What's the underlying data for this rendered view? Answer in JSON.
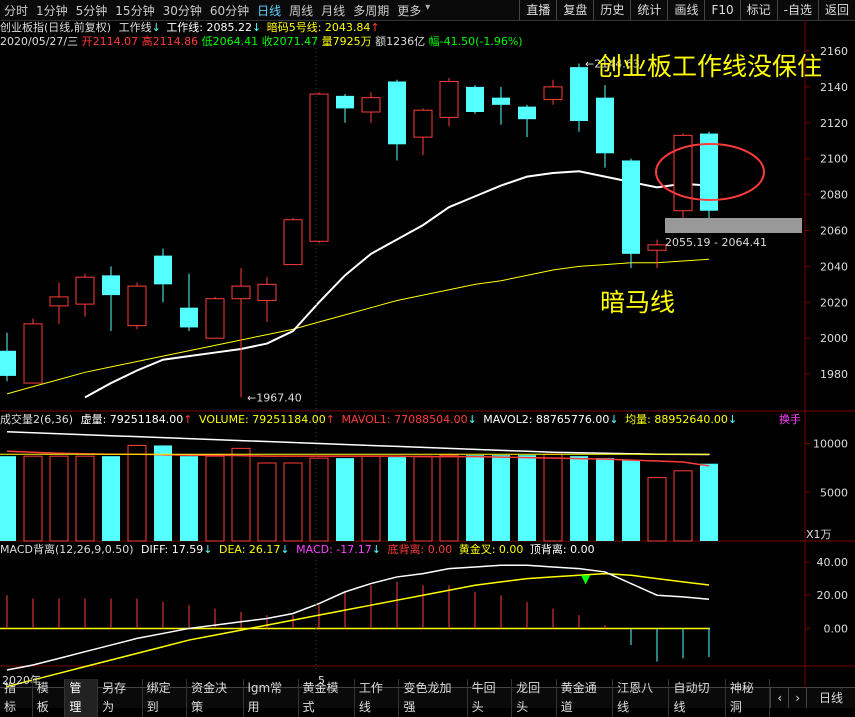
{
  "topbar": {
    "periods": [
      "分时",
      "1分钟",
      "5分钟",
      "15分钟",
      "30分钟",
      "60分钟",
      "日线",
      "周线",
      "月线",
      "多周期",
      "更多"
    ],
    "active_period": "日线",
    "right_buttons": [
      "直播",
      "复盘",
      "历史",
      "统计",
      "画线",
      "F10",
      "标记",
      "-自选",
      "返回"
    ]
  },
  "info": {
    "line1_name": "创业板指(日线,前复权)",
    "line1_ind1": "工作线",
    "line1_ind2": "工作线: 2085.22",
    "line1_ind3": "暗码5号线: 2043.84",
    "line2_date": "2020/05/27/三",
    "line2_open": "开2114.07",
    "line2_high": "高2114.86",
    "line2_low": "低2064.41",
    "line2_close": "收2071.47",
    "line2_vol": "量7925万",
    "line2_amt": "额1236亿",
    "line2_chg": "幅-41.50(-1.96%)"
  },
  "colors": {
    "up": "#ff3b3b",
    "down": "#54ffff",
    "white": "#ffffff",
    "yellow": "#ffff00",
    "grid": "#7a0000"
  },
  "price_axis": [
    "2160",
    "2140",
    "2120",
    "2100",
    "2080",
    "2060",
    "2040",
    "2020",
    "2000",
    "1980"
  ],
  "price_labels": {
    "high": "2144.63",
    "low": "1967.40",
    "box": "2055.19 - 2064.41"
  },
  "annotations": {
    "title": "创业板工作线没保住",
    "line": "暗马线"
  },
  "volume": {
    "label": "成交量2(6,36)",
    "xu": "虚量: 79251184.00",
    "vol": "VOLUME: 79251184.00",
    "mavol1": "MAVOL1: 77088504.00",
    "mavol2": "MAVOL2: 88765776.00",
    "jun": "均量: 88952640.00",
    "huan": "换手",
    "axis": [
      "10000",
      "5000"
    ],
    "unit": "X1万"
  },
  "macd": {
    "label": "MACD背离(12,26,9,0.50)",
    "diff": "DIFF: 17.59",
    "dea": "DEA: 26.17",
    "macd": "MACD: -17.17",
    "dibeili": "底背离: 0.00",
    "huangjincha": "黄金叉: 0.00",
    "dingbeili": "顶背离: 0.00",
    "axis": [
      "40.00",
      "20.00",
      "0.00"
    ]
  },
  "time_axis": {
    "year": "2020年",
    "month": "5"
  },
  "bottom_tabs": [
    "指标",
    "模板",
    "管理",
    "另存为",
    "绑定到",
    "资金决策",
    "lgm常用",
    "黄金模式",
    "工作线",
    "变色龙加强",
    "牛回头",
    "龙回头",
    "黄金通道",
    "江恩八线",
    "自动切线",
    "神秘洞"
  ],
  "bottom_active": "管理",
  "bottom_right": "日线",
  "chart_data": {
    "type": "candlestick",
    "candles": [
      {
        "o": 1993,
        "c": 1979,
        "h": 2003,
        "l": 1976
      },
      {
        "o": 1975,
        "c": 2008,
        "h": 2011,
        "l": 1975
      },
      {
        "o": 2018,
        "c": 2023,
        "h": 2031,
        "l": 2008
      },
      {
        "o": 2019,
        "c": 2034,
        "h": 2036,
        "l": 2012
      },
      {
        "o": 2035,
        "c": 2024,
        "h": 2040,
        "l": 2004
      },
      {
        "o": 2007,
        "c": 2029,
        "h": 2031,
        "l": 2005
      },
      {
        "o": 2046,
        "c": 2030,
        "h": 2050,
        "l": 2020
      },
      {
        "o": 2017,
        "c": 2006,
        "h": 2036,
        "l": 2004
      },
      {
        "o": 2000,
        "c": 2022,
        "h": 2023,
        "l": 2006
      },
      {
        "o": 2022,
        "c": 2029,
        "h": 2039,
        "l": 1967
      },
      {
        "o": 2021,
        "c": 2030,
        "h": 2034,
        "l": 2009
      },
      {
        "o": 2041,
        "c": 2066,
        "h": 2067,
        "l": 2043
      },
      {
        "o": 2054,
        "c": 2136,
        "h": 2137,
        "l": 2053
      },
      {
        "o": 2135,
        "c": 2128,
        "h": 2136,
        "l": 2120
      },
      {
        "o": 2126,
        "c": 2134,
        "h": 2137,
        "l": 2120
      },
      {
        "o": 2143,
        "c": 2108,
        "h": 2144,
        "l": 2099
      },
      {
        "o": 2112,
        "c": 2127,
        "h": 2128,
        "l": 2102
      },
      {
        "o": 2123,
        "c": 2143,
        "h": 2145,
        "l": 2118
      },
      {
        "o": 2140,
        "c": 2126,
        "h": 2141,
        "l": 2125
      },
      {
        "o": 2134,
        "c": 2130,
        "h": 2140,
        "l": 2119
      },
      {
        "o": 2129,
        "c": 2122,
        "h": 2130,
        "l": 2112
      },
      {
        "o": 2133,
        "c": 2140,
        "h": 2144,
        "l": 2130
      },
      {
        "o": 2151,
        "c": 2121,
        "h": 2153,
        "l": 2115
      },
      {
        "o": 2134,
        "c": 2103,
        "h": 2141,
        "l": 2095
      },
      {
        "o": 2099,
        "c": 2047,
        "h": 2100,
        "l": 2039
      },
      {
        "o": 2049,
        "c": 2052,
        "h": 2055,
        "l": 2039
      },
      {
        "o": 2071,
        "c": 2113,
        "h": 2114,
        "l": 2067
      },
      {
        "o": 2114,
        "c": 2071,
        "h": 2115,
        "l": 2064
      }
    ],
    "work_line": [
      null,
      null,
      null,
      1967,
      1975,
      1982,
      1988,
      1990,
      1992,
      1994,
      1997,
      2004,
      2020,
      2035,
      2047,
      2055,
      2063,
      2073,
      2079,
      2085,
      2090,
      2092,
      2093,
      2090,
      2087,
      2084,
      2086,
      2085
    ],
    "ma_yellow": [
      1969,
      1973,
      1977,
      1981,
      1984,
      1987,
      1990,
      1993,
      1996,
      1999,
      2002,
      2005,
      2009,
      2013,
      2017,
      2021,
      2024,
      2027,
      2030,
      2032,
      2035,
      2038,
      2040,
      2041,
      2042,
      2042,
      2043,
      2044
    ],
    "volume_values": [
      8700,
      8700,
      8700,
      8700,
      8700,
      9800,
      9800,
      8700,
      8700,
      9500,
      8000,
      8000,
      8500,
      8500,
      8700,
      8600,
      8700,
      8800,
      8800,
      8800,
      8800,
      8900,
      8700,
      8500,
      8300,
      6500,
      7200,
      7925
    ],
    "mavol1": [
      9200,
      9100,
      9000,
      8950,
      8900,
      8900,
      8850,
      8800,
      8800,
      8750,
      8700,
      8700,
      8700,
      8700,
      8700,
      8700,
      8650,
      8650,
      8650,
      8600,
      8550,
      8500,
      8450,
      8400,
      8300,
      8200,
      8100,
      7709
    ],
    "mavol2": [
      11200,
      11100,
      11000,
      10900,
      10800,
      10700,
      10600,
      10500,
      10400,
      10300,
      10200,
      10100,
      10000,
      9900,
      9800,
      9700,
      9600,
      9500,
      9400,
      9300,
      9200,
      9100,
      9050,
      9000,
      8950,
      8900,
      8880,
      8877
    ],
    "macd_diff": [
      -25,
      -22,
      -18,
      -14,
      -10,
      -6,
      -3,
      0,
      2,
      4,
      6,
      9,
      15,
      22,
      27,
      31,
      33,
      36,
      37,
      38,
      38,
      37,
      36,
      34,
      27,
      20,
      19,
      17.59
    ],
    "macd_dea": [
      -35,
      -31,
      -27,
      -23,
      -19,
      -15,
      -11,
      -7,
      -4,
      -1,
      2,
      5,
      8,
      11,
      14,
      17,
      20,
      23,
      26,
      28,
      30,
      31,
      32,
      33,
      32,
      30,
      28,
      26.17
    ],
    "macd_hist": [
      20,
      18,
      18,
      18,
      18,
      18,
      16,
      14,
      12,
      10,
      8,
      8,
      14,
      22,
      26,
      28,
      26,
      26,
      22,
      20,
      16,
      12,
      8,
      2,
      -10,
      -20,
      -18,
      -17.17
    ],
    "price_range": [
      1960,
      2165
    ],
    "volume_range": [
      0,
      12000
    ],
    "macd_range": [
      -22,
      46
    ]
  }
}
